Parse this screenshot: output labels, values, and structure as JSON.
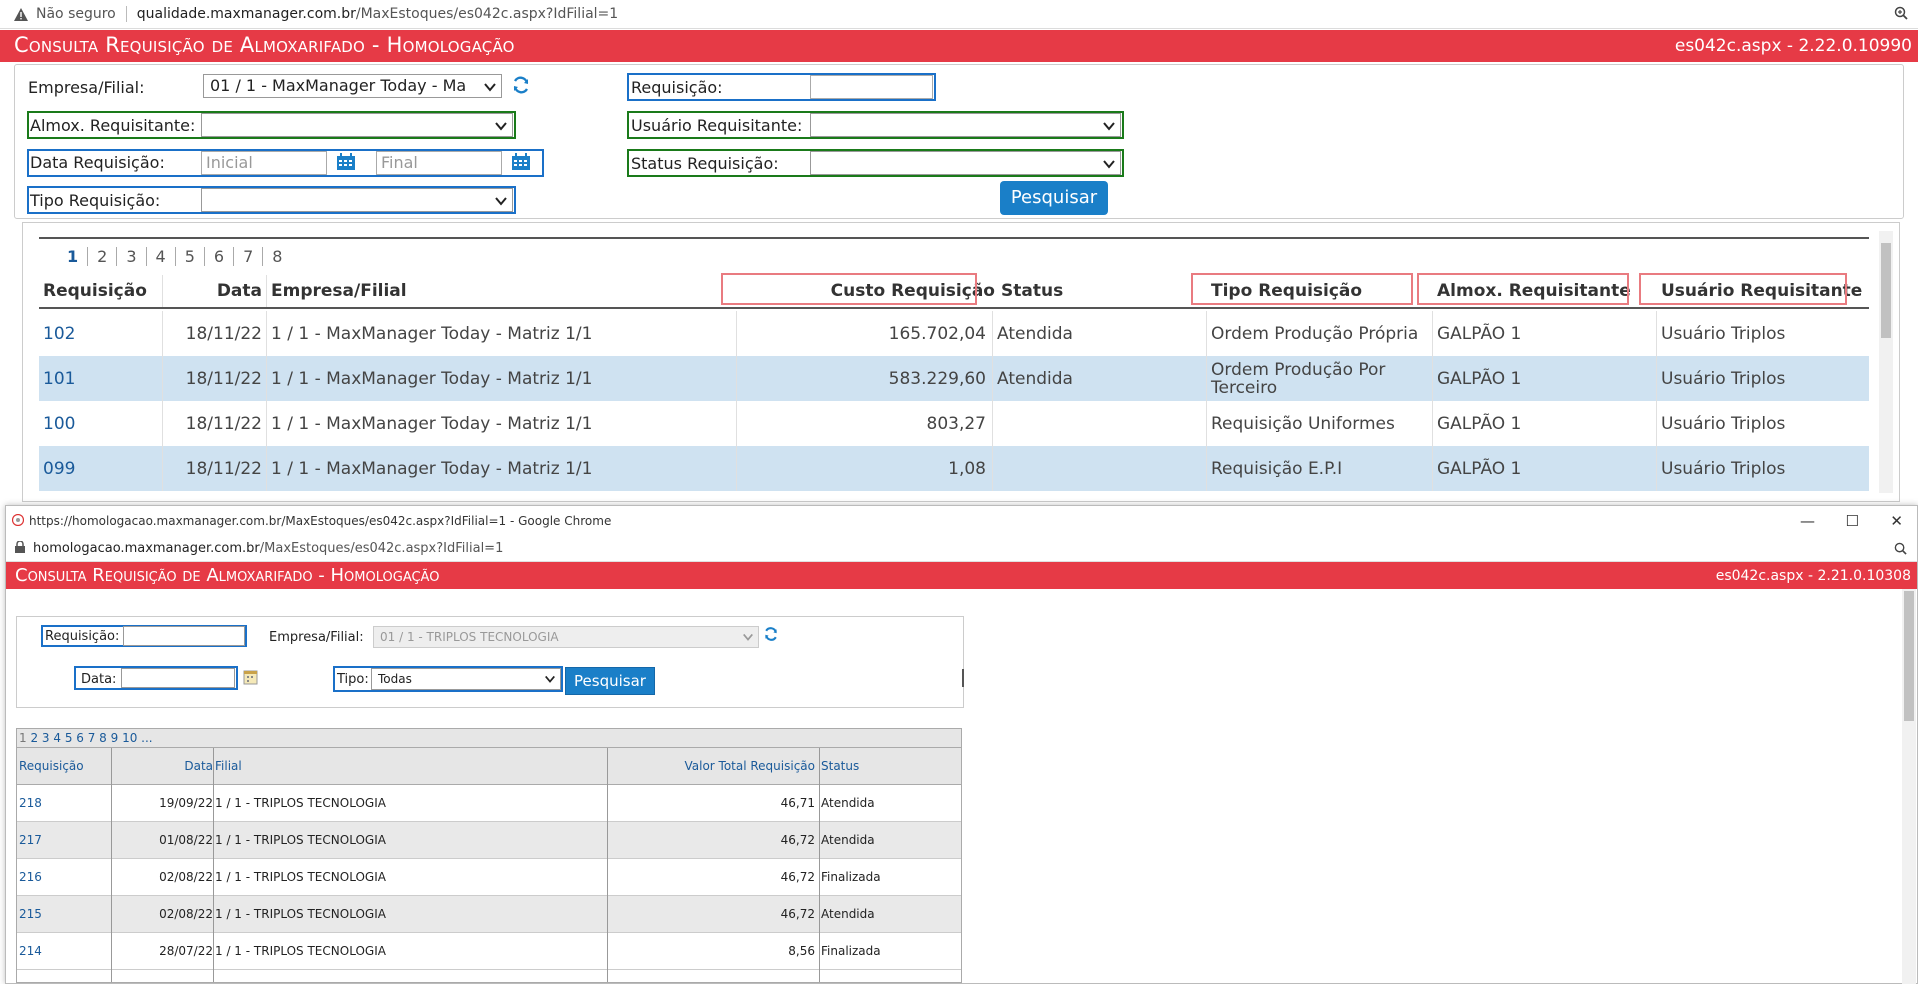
{
  "back": {
    "browser": {
      "security": "Não seguro",
      "url_host": "qualidade.maxmanager.com.br",
      "url_path": "/MaxEstoques/es042c.aspx?IdFilial=1"
    },
    "header": {
      "title": "Consulta Requisição de Almoxarifado  - Homologação",
      "version": "es042c.aspx - 2.22.0.10990"
    },
    "form": {
      "empresa_label": "Empresa/Filial:",
      "empresa_value": "01 / 1 - MaxManager Today - Ma",
      "requisicao_label": "Requisição:",
      "almox_label": "Almox. Requisitante:",
      "usuario_label": "Usuário Requisitante:",
      "data_label": "Data Requisição:",
      "data_inicial_placeholder": "Inicial",
      "data_final_placeholder": "Final",
      "status_label": "Status Requisição:",
      "tipo_label": "Tipo Requisição:",
      "search_label": "Pesquisar"
    },
    "grid": {
      "pages": [
        "1",
        "2",
        "3",
        "4",
        "5",
        "6",
        "7",
        "8"
      ],
      "columns": {
        "requisicao": "Requisição",
        "data": "Data",
        "empresa": "Empresa/Filial",
        "custo": "Custo Requisição",
        "status": "Status",
        "tipo": "Tipo Requisição",
        "almox": "Almox. Requisitante",
        "usuario": "Usuário Requisitante"
      },
      "rows": [
        {
          "req": "102",
          "data": "18/11/22",
          "empresa": "1 / 1 - MaxManager Today - Matriz 1/1",
          "custo": "165.702,04",
          "status": "Atendida",
          "tipo": "Ordem Produção Própria",
          "almox": "GALPÃO 1",
          "usuario": "Usuário Triplos"
        },
        {
          "req": "101",
          "data": "18/11/22",
          "empresa": "1 / 1 - MaxManager Today - Matriz 1/1",
          "custo": "583.229,60",
          "status": "Atendida",
          "tipo": "Ordem Produção Por Terceiro",
          "almox": "GALPÃO 1",
          "usuario": "Usuário Triplos"
        },
        {
          "req": "100",
          "data": "18/11/22",
          "empresa": "1 / 1 - MaxManager Today - Matriz 1/1",
          "custo": "803,27",
          "status": "",
          "tipo": "Requisição Uniformes",
          "almox": "GALPÃO 1",
          "usuario": "Usuário Triplos"
        },
        {
          "req": "099",
          "data": "18/11/22",
          "empresa": "1 / 1 - MaxManager Today - Matriz 1/1",
          "custo": "1,08",
          "status": "",
          "tipo": "Requisição E.P.I",
          "almox": "GALPÃO 1",
          "usuario": "Usuário Triplos"
        }
      ]
    }
  },
  "front": {
    "window_title": "https://homologacao.maxmanager.com.br/MaxEstoques/es042c.aspx?IdFilial=1 - Google Chrome",
    "url_host": "homologacao.maxmanager.com.br",
    "url_path": "/MaxEstoques/es042c.aspx?IdFilial=1",
    "header": {
      "title": "Consulta Requisição de Almoxarifado  - Homologação",
      "version": "es042c.aspx - 2.21.0.10308"
    },
    "form": {
      "requisicao_label": "Requisição:",
      "empresa_label": "Empresa/Filial:",
      "empresa_value": "01 / 1 - TRIPLOS TECNOLOGIA",
      "data_label": "Data:",
      "tipo_label": "Tipo:",
      "tipo_value": "Todas",
      "search_label": "Pesquisar"
    },
    "grid": {
      "pager_current": "1",
      "pager_rest": "2 3 4 5 6 7 8 9 10 ...",
      "columns": {
        "requisicao": "Requisição",
        "data": "Data",
        "filial": "Filial",
        "valor": "Valor Total Requisição",
        "status": "Status"
      },
      "rows": [
        {
          "req": "218",
          "data": "19/09/22",
          "filial": "1 / 1 - TRIPLOS TECNOLOGIA",
          "valor": "46,71",
          "status": "Atendida"
        },
        {
          "req": "217",
          "data": "01/08/22",
          "filial": "1 / 1 - TRIPLOS TECNOLOGIA",
          "valor": "46,72",
          "status": "Atendida"
        },
        {
          "req": "216",
          "data": "02/08/22",
          "filial": "1 / 1 - TRIPLOS TECNOLOGIA",
          "valor": "46,72",
          "status": "Finalizada"
        },
        {
          "req": "215",
          "data": "02/08/22",
          "filial": "1 / 1 - TRIPLOS TECNOLOGIA",
          "valor": "46,72",
          "status": "Atendida"
        },
        {
          "req": "214",
          "data": "28/07/22",
          "filial": "1 / 1 - TRIPLOS TECNOLOGIA",
          "valor": "8,56",
          "status": "Finalizada"
        }
      ]
    }
  },
  "colors": {
    "header_red": "#e63a46",
    "button_blue": "#1a7fc8",
    "highlight_blue": "#1a70c8",
    "highlight_green": "#1a7a1a",
    "highlight_red": "#e97b80",
    "row_alt": "#cfe2f1"
  }
}
